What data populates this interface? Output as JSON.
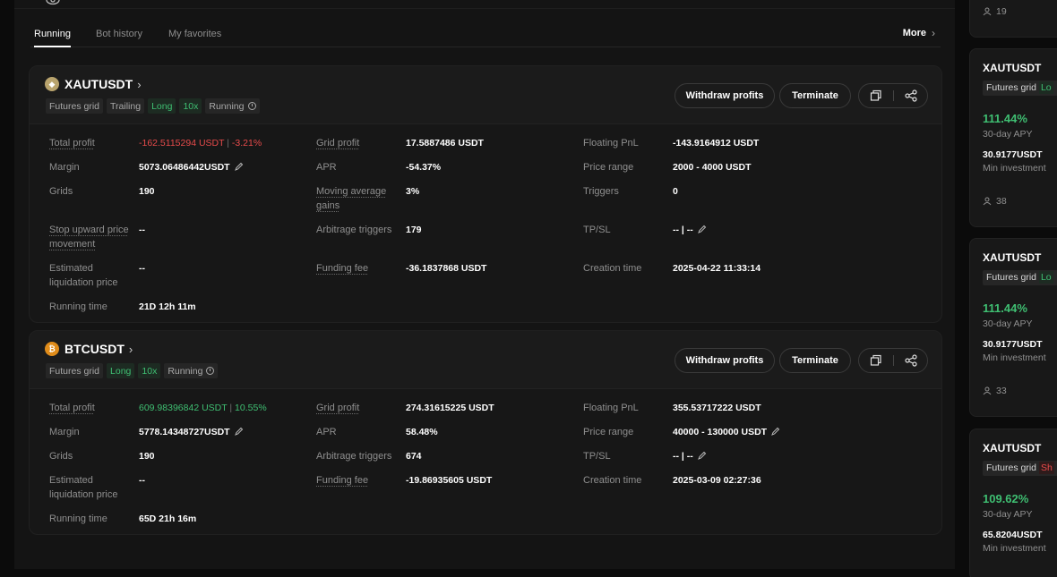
{
  "tabs": [
    {
      "label": "Running",
      "active": true
    },
    {
      "label": "Bot history",
      "active": false
    },
    {
      "label": "My favorites",
      "active": false
    }
  ],
  "more_label": "More",
  "bots": [
    {
      "pair": "XAUTUSDT",
      "coin_icon": "gold-coin-icon",
      "tags": [
        "Futures grid",
        "Trailing",
        "Long",
        "10x",
        "Running"
      ],
      "buttons": {
        "withdraw": "Withdraw profits",
        "terminate": "Terminate"
      },
      "fields": {
        "total_profit_label": "Total profit",
        "total_profit_value": "-162.5115294 USDT",
        "total_profit_pct": "-3.21%",
        "grid_profit_label": "Grid profit",
        "grid_profit_value": "17.5887486 USDT",
        "floating_pnl_label": "Floating PnL",
        "floating_pnl_value": "-143.9164912 USDT",
        "margin_label": "Margin",
        "margin_value": "5073.06486442USDT",
        "apr_label": "APR",
        "apr_value": "-54.37%",
        "price_range_label": "Price range",
        "price_range_value": "2000 - 4000 USDT",
        "grids_label": "Grids",
        "grids_value": "190",
        "mag_label_1": "Moving average",
        "mag_label_2": "gains",
        "mag_value": "3%",
        "triggers_label": "Triggers",
        "triggers_value": "0",
        "stop_up_label_1": "Stop upward price",
        "stop_up_label_2": "movement",
        "stop_up_value": "--",
        "arb_label": "Arbitrage triggers",
        "arb_value": "179",
        "tpsl_label": "TP/SL",
        "tpsl_value": "-- | --",
        "liq_label_1": "Estimated",
        "liq_label_2": "liquidation price",
        "liq_value": "--",
        "funding_label": "Funding fee",
        "funding_value": "-36.1837868 USDT",
        "creation_label": "Creation time",
        "creation_value": "2025-04-22 11:33:14",
        "running_label": "Running time",
        "running_value": "21D 12h 11m"
      }
    },
    {
      "pair": "BTCUSDT",
      "coin_icon": "bitcoin-coin-icon",
      "tags": [
        "Futures grid",
        "Long",
        "10x",
        "Running"
      ],
      "buttons": {
        "withdraw": "Withdraw profits",
        "terminate": "Terminate"
      },
      "fields": {
        "total_profit_label": "Total profit",
        "total_profit_value": "609.98396842 USDT",
        "total_profit_pct": "10.55%",
        "grid_profit_label": "Grid profit",
        "grid_profit_value": "274.31615225 USDT",
        "floating_pnl_label": "Floating PnL",
        "floating_pnl_value": "355.53717222 USDT",
        "margin_label": "Margin",
        "margin_value": "5778.14348727USDT",
        "apr_label": "APR",
        "apr_value": "58.48%",
        "price_range_label": "Price range",
        "price_range_value": "40000 - 130000 USDT",
        "grids_label": "Grids",
        "grids_value": "190",
        "arb_label": "Arbitrage triggers",
        "arb_value": "674",
        "tpsl_label": "TP/SL",
        "tpsl_value": "-- | --",
        "liq_label_1": "Estimated",
        "liq_label_2": "liquidation price",
        "liq_value": "--",
        "funding_label": "Funding fee",
        "funding_value": "-19.86935605 USDT",
        "creation_label": "Creation time",
        "creation_value": "2025-03-09 02:27:36",
        "running_label": "Running time",
        "running_value": "65D 21h 16m"
      }
    }
  ],
  "sidebar": {
    "top_users": "19",
    "cards": [
      {
        "pair": "XAUTUSDT",
        "tag": "Futures grid",
        "dir": "Lo",
        "apy": "111.44%",
        "apy_label": "30-day APY",
        "inv": "30.9177USDT",
        "inv_label": "Min investment",
        "users": "38"
      },
      {
        "pair": "XAUTUSDT",
        "tag": "Futures grid",
        "dir": "Lo",
        "apy": "111.44%",
        "apy_label": "30-day APY",
        "inv": "30.9177USDT",
        "inv_label": "Min investment",
        "users": "33"
      },
      {
        "pair": "XAUTUSDT",
        "tag": "Futures grid",
        "dir": "Sh",
        "apy": "109.62%",
        "apy_label": "30-day APY",
        "inv": "65.8204USDT",
        "inv_label": "Min investment"
      }
    ]
  },
  "colors": {
    "profit_green": "#3fbf72",
    "loss_red": "#e84b4b",
    "bg": "#0b0b0b",
    "card": "#1b1b1b"
  }
}
